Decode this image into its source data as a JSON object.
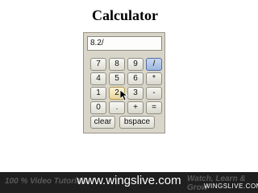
{
  "page": {
    "title": "Calculator"
  },
  "calculator": {
    "display_value": "8.2/",
    "keys": {
      "k7": "7",
      "k8": "8",
      "k9": "9",
      "div": "/",
      "k4": "4",
      "k5": "5",
      "k6": "6",
      "mul": "*",
      "k1": "1",
      "k2": "2",
      "k3": "3",
      "sub": "-",
      "k0": "0",
      "dot": ".",
      "add": "+",
      "eq": "="
    },
    "clear_label": "clear",
    "bspace_label": "bspace"
  },
  "footer": {
    "left_text": "100 % Video Tutorials",
    "url": "www.wingslive.com",
    "right_faded_text": "Watch, Learn & Grow",
    "logo_text": "WINGSLIVE.COM"
  },
  "colors": {
    "active_key": "#9cb6de",
    "hover_key": "#e9d59a",
    "footer_bg": "#1f1f1f"
  }
}
